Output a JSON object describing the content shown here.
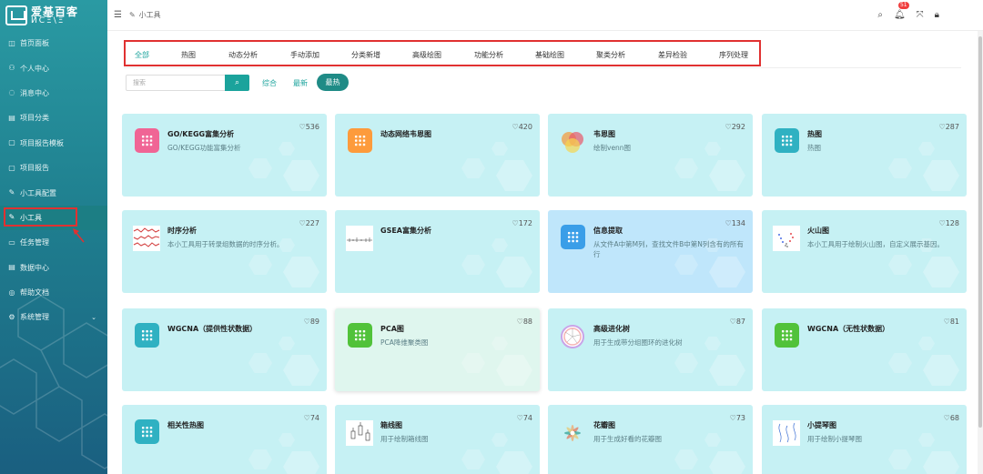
{
  "app": {
    "logo_line1": "爱基百客",
    "logo_line2": "ИCΞ\\Ξ"
  },
  "sidebar": {
    "items": [
      {
        "label": "首页面板",
        "icon": "dashboard-icon",
        "glyph": "◫"
      },
      {
        "label": "个人中心",
        "icon": "user-icon",
        "glyph": "⚇"
      },
      {
        "label": "消息中心",
        "icon": "message-icon",
        "glyph": "◌"
      },
      {
        "label": "项目分类",
        "icon": "category-icon",
        "glyph": "▤"
      },
      {
        "label": "项目报告模板",
        "icon": "template-icon",
        "glyph": "▢"
      },
      {
        "label": "项目报告",
        "icon": "report-icon",
        "glyph": "▢"
      },
      {
        "label": "小工具配置",
        "icon": "tool-config-icon",
        "glyph": "✎"
      },
      {
        "label": "小工具",
        "icon": "tool-icon",
        "glyph": "✎"
      },
      {
        "label": "任务管理",
        "icon": "task-icon",
        "glyph": "▭"
      },
      {
        "label": "数据中心",
        "icon": "data-icon",
        "glyph": "▤"
      },
      {
        "label": "帮助文档",
        "icon": "help-icon",
        "glyph": "◎"
      },
      {
        "label": "系统管理",
        "icon": "settings-icon",
        "glyph": "⚙"
      }
    ]
  },
  "topbar": {
    "breadcrumb": "小工具",
    "notification_count": "51"
  },
  "tabs": [
    "全部",
    "热图",
    "动态分析",
    "手动添加",
    "分类新增",
    "高级绘图",
    "功能分析",
    "基础绘图",
    "聚类分析",
    "差异检验",
    "序列处理"
  ],
  "search": {
    "placeholder": "搜索"
  },
  "sort": {
    "option1": "综合",
    "option2": "最新",
    "option3": "最热"
  },
  "cards": [
    {
      "title": "GO/KEGG富集分析",
      "desc": "GO/KEGG功能富集分析",
      "likes": "♡536"
    },
    {
      "title": "动态网络韦恩图",
      "desc": "",
      "likes": "♡420"
    },
    {
      "title": "韦恩图",
      "desc": "绘制venn图",
      "likes": "♡292"
    },
    {
      "title": "热图",
      "desc": "热图",
      "likes": "♡287"
    },
    {
      "title": "时序分析",
      "desc": "本小工具用于转录组数据的时序分析。",
      "likes": "♡227"
    },
    {
      "title": "GSEA富集分析",
      "desc": "",
      "likes": "♡172"
    },
    {
      "title": "信息提取",
      "desc": "从文件A中第M列，查找文件B中第N列含有的所有行",
      "likes": "♡134"
    },
    {
      "title": "火山图",
      "desc": "本小工具用于绘制火山图，自定义展示基因。",
      "likes": "♡128"
    },
    {
      "title": "WGCNA（提供性状数据）",
      "desc": "",
      "likes": "♡89"
    },
    {
      "title": "PCA图",
      "desc": "PCA降维聚类图",
      "likes": "♡88"
    },
    {
      "title": "高级进化树",
      "desc": "用于生成带分组圈环的进化树",
      "likes": "♡87"
    },
    {
      "title": "WGCNA（无性状数据）",
      "desc": "",
      "likes": "♡81"
    },
    {
      "title": "相关性热图",
      "desc": "",
      "likes": "♡74"
    },
    {
      "title": "箱线图",
      "desc": "用于绘制箱线图",
      "likes": "♡74"
    },
    {
      "title": "花瓣图",
      "desc": "用于生成好看的花瓣图",
      "likes": "♡73"
    },
    {
      "title": "小提琴图",
      "desc": "用于绘制小提琴图",
      "likes": "♡68"
    }
  ],
  "colors": {
    "accent": "#1ba39c",
    "highlight_red": "#e03131",
    "card_bg": "#c6f1f4"
  }
}
